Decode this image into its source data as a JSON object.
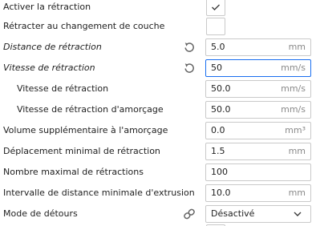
{
  "settings": [
    {
      "label": "Activer la rétraction",
      "control": "checkbox",
      "checked": true
    },
    {
      "label": "Rétracter au changement de couche",
      "control": "checkbox",
      "checked": false
    },
    {
      "label": "Distance de rétraction",
      "control": "field",
      "value": "5.0",
      "unit": "mm",
      "overridden": true
    },
    {
      "label": "Vitesse de rétraction",
      "control": "field",
      "value": "50",
      "unit": "mm/s",
      "overridden": true,
      "focused": true
    },
    {
      "label": "Vitesse de rétraction",
      "control": "field",
      "value": "50.0",
      "unit": "mm/s",
      "indented": true
    },
    {
      "label": "Vitesse de rétraction d'amorçage",
      "control": "field",
      "value": "50.0",
      "unit": "mm/s",
      "indented": true
    },
    {
      "label": "Volume supplémentaire à l'amorçage",
      "control": "field",
      "value": "0.0",
      "unit": "mm³"
    },
    {
      "label": "Déplacement minimal de rétraction",
      "control": "field",
      "value": "1.5",
      "unit": "mm"
    },
    {
      "label": "Nombre maximal de rétractions",
      "control": "field",
      "value": "100",
      "unit": ""
    },
    {
      "label": "Intervalle de distance minimale d'extrusion",
      "control": "field",
      "value": "10.0",
      "unit": "mm"
    },
    {
      "label": "Mode de détours",
      "control": "select",
      "value": "Désactivé",
      "linked": true
    }
  ],
  "colors": {
    "focus_border": "#196ef0",
    "field_border": "#c9c9c9",
    "icon": "#666666",
    "unit_text": "#8a8a8a"
  },
  "icons": {
    "reset": "reset-icon",
    "link": "link-icon",
    "check": "check-icon",
    "dropdown": "chevron-down-icon"
  }
}
